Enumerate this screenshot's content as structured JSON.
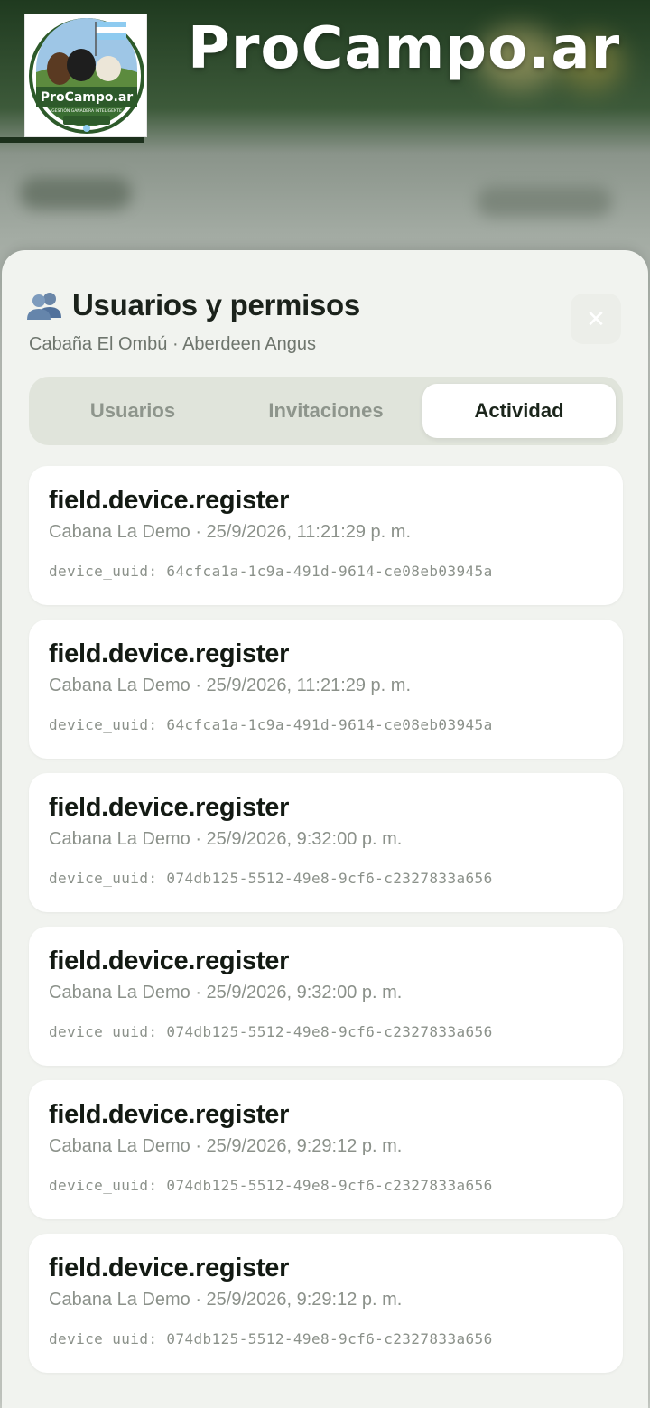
{
  "app": {
    "brand_title": "ProCampo.ar",
    "logo_text": "ProCampo.ar",
    "logo_tagline": "GESTIÓN GANADERA INTELIGENTE"
  },
  "modal": {
    "title": "Usuarios y permisos",
    "title_icon": "people-icon",
    "subtitle": "Cabaña El Ombú · Aberdeen Angus",
    "close_icon": "close-icon",
    "close_glyph": "✕"
  },
  "tabs": [
    {
      "label": "Usuarios",
      "active": false
    },
    {
      "label": "Invitaciones",
      "active": false
    },
    {
      "label": "Actividad",
      "active": true
    }
  ],
  "activity": [
    {
      "action": "field.device.register",
      "meta": "Cabana La Demo · 25/9/2026, 11:21:29 p. m.",
      "detail": "device_uuid: 64cfca1a-1c9a-491d-9614-ce08eb03945a"
    },
    {
      "action": "field.device.register",
      "meta": "Cabana La Demo · 25/9/2026, 11:21:29 p. m.",
      "detail": "device_uuid: 64cfca1a-1c9a-491d-9614-ce08eb03945a"
    },
    {
      "action": "field.device.register",
      "meta": "Cabana La Demo · 25/9/2026, 9:32:00 p. m.",
      "detail": "device_uuid: 074db125-5512-49e8-9cf6-c2327833a656"
    },
    {
      "action": "field.device.register",
      "meta": "Cabana La Demo · 25/9/2026, 9:32:00 p. m.",
      "detail": "device_uuid: 074db125-5512-49e8-9cf6-c2327833a656"
    },
    {
      "action": "field.device.register",
      "meta": "Cabana La Demo · 25/9/2026, 9:29:12 p. m.",
      "detail": "device_uuid: 074db125-5512-49e8-9cf6-c2327833a656"
    },
    {
      "action": "field.device.register",
      "meta": "Cabana La Demo · 25/9/2026, 9:29:12 p. m.",
      "detail": "device_uuid: 074db125-5512-49e8-9cf6-c2327833a656"
    }
  ],
  "colors": {
    "brand_green": "#1f3a1f",
    "sheet_bg": "#f1f3ef",
    "tab_track": "#e0e4db",
    "text_primary": "#131a13",
    "text_muted": "#8b918a"
  }
}
